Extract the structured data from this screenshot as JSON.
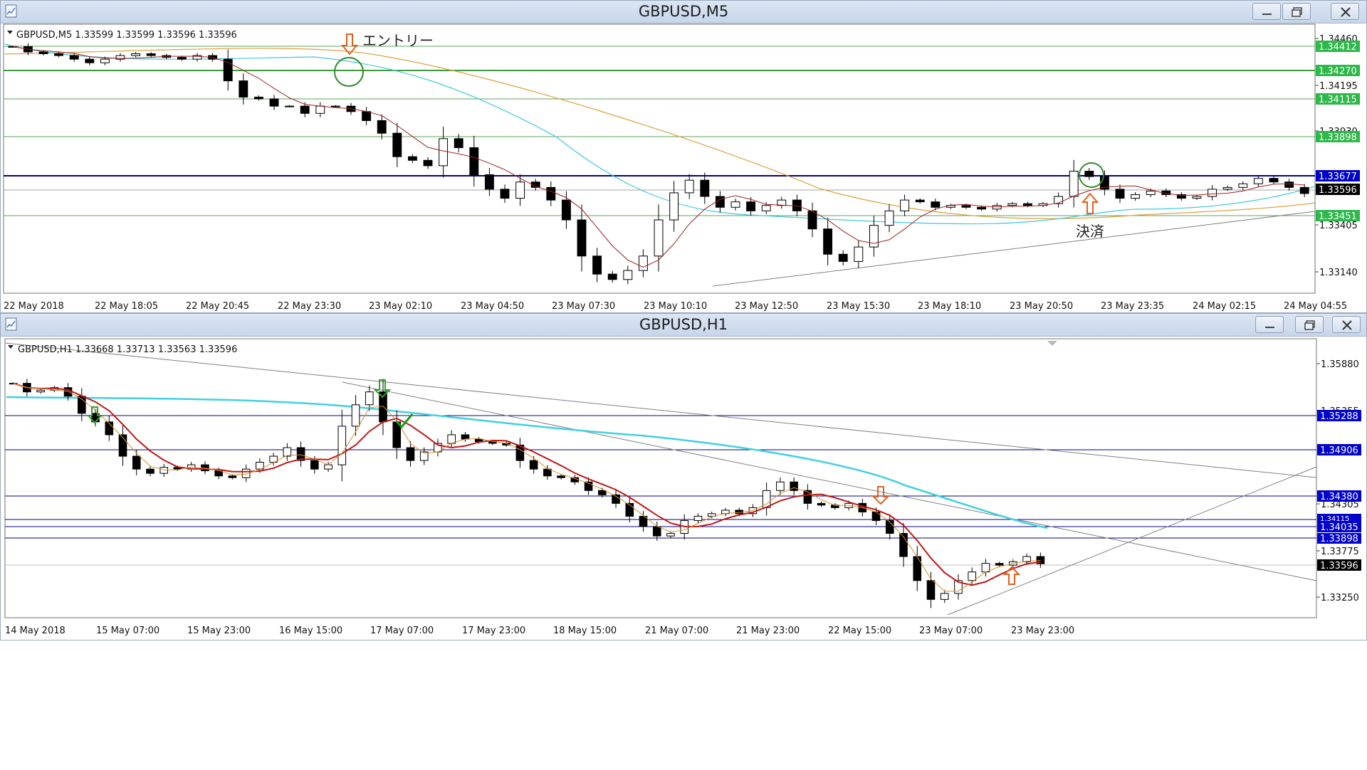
{
  "windows": [
    {
      "id": "m5",
      "title": "GBPUSD,M5",
      "info": "GBPUSD,M5  1.33599 1.33599 1.33596 1.33596",
      "price_scale": [
        "1.34460",
        "1.34195",
        "1.33930",
        "1.33405",
        "1.33140"
      ],
      "time_labels": [
        "22 May 2018",
        "22 May 18:05",
        "22 May 20:45",
        "22 May 23:30",
        "23 May 02:10",
        "23 May 04:50",
        "23 May 07:30",
        "23 May 10:10",
        "23 May 12:50",
        "23 May 15:30",
        "23 May 18:10",
        "23 May 20:50",
        "23 May 23:35",
        "24 May 02:15",
        "24 May 04:55"
      ],
      "level_badges": [
        {
          "value": "1.34412",
          "color": "#2db84a"
        },
        {
          "value": "1.34270",
          "color": "#2db84a"
        },
        {
          "value": "1.34115",
          "color": "#2db84a"
        },
        {
          "value": "1.33898",
          "color": "#2db84a"
        },
        {
          "value": "1.33677",
          "color": "#0000cc"
        },
        {
          "value": "1.33596",
          "color": "#000000"
        },
        {
          "value": "1.33451",
          "color": "#2db84a"
        }
      ],
      "annotations": {
        "entry": "エントリー",
        "exit": "決済"
      },
      "chart_data": {
        "type": "candlestick",
        "x_start": "22 May 2018",
        "x_end": "24 May 04:55",
        "ylim": [
          1.3306,
          1.3451
        ],
        "last": 1.33596,
        "closes": [
          1.3441,
          1.3438,
          1.3437,
          1.3436,
          1.3434,
          1.3432,
          1.3434,
          1.3436,
          1.3437,
          1.3436,
          1.3435,
          1.3434,
          1.3436,
          1.3434,
          1.3422,
          1.3413,
          1.3412,
          1.3408,
          1.3408,
          1.3404,
          1.3408,
          1.3408,
          1.3405,
          1.34,
          1.3393,
          1.338,
          1.3378,
          1.3375,
          1.339,
          1.3385,
          1.337,
          1.3362,
          1.3357,
          1.3366,
          1.3363,
          1.3356,
          1.3345,
          1.3325,
          1.3315,
          1.3312,
          1.3317,
          1.3325,
          1.3345,
          1.336,
          1.3367,
          1.3358,
          1.3352,
          1.3355,
          1.335,
          1.3353,
          1.3356,
          1.335,
          1.334,
          1.3326,
          1.3322,
          1.333,
          1.3342,
          1.335,
          1.3356,
          1.3355,
          1.3352,
          1.3353,
          1.3352,
          1.3351,
          1.3353,
          1.3354,
          1.3353,
          1.3354,
          1.3358,
          1.3372,
          1.3369,
          1.3362,
          1.3357,
          1.3359,
          1.3361,
          1.3359,
          1.3357,
          1.3358,
          1.3362,
          1.3363,
          1.3365,
          1.3368,
          1.3366,
          1.3363,
          1.33596
        ]
      }
    },
    {
      "id": "h1",
      "title": "GBPUSD,H1",
      "info": "GBPUSD,H1  1.33668 1.33713 1.33563 1.33596",
      "price_scale": [
        "1.35880",
        "1.35355",
        "1.34305",
        "1.33775",
        "1.33250"
      ],
      "time_labels": [
        "14 May 2018",
        "15 May 07:00",
        "15 May 23:00",
        "16 May 15:00",
        "17 May 07:00",
        "17 May 23:00",
        "18 May 15:00",
        "21 May 07:00",
        "21 May 23:00",
        "22 May 15:00",
        "23 May 07:00",
        "23 May 23:00"
      ],
      "level_badges": [
        {
          "value": "1.35288",
          "color": "#0000cc"
        },
        {
          "value": "1.34906",
          "color": "#0000cc"
        },
        {
          "value": "1.34380",
          "color": "#0000cc"
        },
        {
          "value": "1.34115",
          "color": "#0000cc"
        },
        {
          "value": "1.34035",
          "color": "#0000cc"
        },
        {
          "value": "1.33898",
          "color": "#0000cc"
        },
        {
          "value": "1.33596",
          "color": "#000000"
        }
      ],
      "chart_data": {
        "type": "candlestick",
        "x_start": "14 May 2018",
        "x_end": "23 May 23:00",
        "ylim": [
          1.33,
          1.3617
        ],
        "last": 1.33596,
        "closes": [
          1.357,
          1.356,
          1.3562,
          1.3565,
          1.3555,
          1.3535,
          1.3525,
          1.351,
          1.3485,
          1.347,
          1.3465,
          1.3472,
          1.347,
          1.3475,
          1.3468,
          1.3462,
          1.346,
          1.347,
          1.3478,
          1.3485,
          1.3495,
          1.348,
          1.347,
          1.3475,
          1.352,
          1.3545,
          1.356,
          1.3525,
          1.3495,
          1.348,
          1.349,
          1.35,
          1.351,
          1.3505,
          1.3502,
          1.35,
          1.3498,
          1.348,
          1.347,
          1.3462,
          1.346,
          1.3455,
          1.3445,
          1.344,
          1.343,
          1.3415,
          1.3403,
          1.3392,
          1.3395,
          1.341,
          1.3415,
          1.3418,
          1.3422,
          1.3418,
          1.3425,
          1.3445,
          1.3455,
          1.3445,
          1.343,
          1.3428,
          1.3425,
          1.343,
          1.342,
          1.341,
          1.3395,
          1.3368,
          1.334,
          1.3318,
          1.3325,
          1.334,
          1.335,
          1.336,
          1.3358,
          1.3362,
          1.3368,
          1.33596
        ]
      }
    }
  ]
}
